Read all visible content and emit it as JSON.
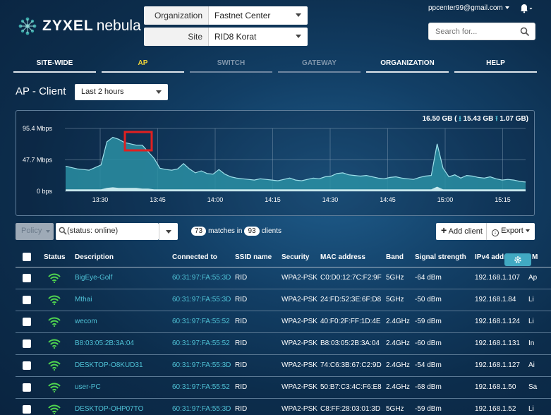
{
  "brand": {
    "name": "ZYXEL",
    "product": "nebula"
  },
  "org_selector": {
    "label": "Organization",
    "value": "Fastnet Center"
  },
  "site_selector": {
    "label": "Site",
    "value": "RID8 Korat"
  },
  "user": {
    "email": "ppcenter99@gmail.com"
  },
  "search": {
    "placeholder": "Search for..."
  },
  "nav": {
    "tabs": [
      {
        "label": "SITE-WIDE"
      },
      {
        "label": "AP"
      },
      {
        "label": "SWITCH"
      },
      {
        "label": "GATEWAY"
      },
      {
        "label": "ORGANIZATION"
      },
      {
        "label": "HELP"
      }
    ]
  },
  "page": {
    "title": "AP - Client",
    "time_range": "Last 2 hours"
  },
  "usage": {
    "total": "16.50 GB (",
    "down": "15.43 GB",
    "up": "1.07 GB)"
  },
  "chart_data": {
    "type": "area",
    "y_ticks": [
      "95.4 Mbps",
      "47.7 Mbps",
      "0 bps"
    ],
    "ylim": [
      0,
      95.4
    ],
    "x_ticks": [
      "13:30",
      "13:45",
      "14:00",
      "14:15",
      "14:30",
      "14:45",
      "15:00",
      "15:15"
    ],
    "grid": true,
    "series": [
      {
        "values": [
          38,
          36,
          34,
          33,
          32,
          36,
          40,
          75,
          82,
          79,
          74,
          72,
          70,
          70,
          60,
          50,
          35,
          33,
          32,
          34,
          42,
          34,
          28,
          31,
          27,
          26,
          33,
          26,
          22,
          20,
          19,
          18,
          17,
          19,
          18,
          17,
          16,
          18,
          20,
          17,
          16,
          18,
          20,
          19,
          22,
          23,
          27,
          28,
          25,
          24,
          23,
          24,
          22,
          20,
          19,
          21,
          22,
          20,
          19,
          18,
          21,
          23,
          24,
          72,
          35,
          22,
          25,
          20,
          24,
          23,
          21,
          20,
          22,
          19,
          17,
          18,
          17,
          15,
          14
        ]
      },
      {
        "values": [
          3,
          3,
          3,
          3,
          3,
          3,
          3,
          5,
          6,
          5,
          5,
          5,
          5,
          4,
          4,
          3,
          3,
          3,
          3,
          3,
          3,
          3,
          3,
          3,
          3,
          3,
          3,
          3,
          3,
          3,
          3,
          3,
          3,
          3,
          3,
          3,
          3,
          3,
          3,
          3,
          3,
          3,
          3,
          3,
          3,
          3,
          3,
          3,
          3,
          3,
          3,
          3,
          3,
          3,
          3,
          3,
          3,
          3,
          3,
          3,
          3,
          3,
          3,
          7,
          3,
          3,
          3,
          3,
          3,
          3,
          3,
          3,
          3,
          3,
          3,
          3,
          3,
          3,
          3
        ]
      }
    ]
  },
  "toolbar": {
    "policy_label": "Policy",
    "filter_value": "(status: online)",
    "matches_count": "73",
    "matches_in": "matches in",
    "clients_total": "93",
    "clients_label": "clients",
    "add_client": "Add client",
    "export": "Export"
  },
  "table": {
    "headers": [
      "Status",
      "Description",
      "Connected to",
      "SSID name",
      "Security",
      "MAC address",
      "Band",
      "Signal strength",
      "IPv4 addr",
      "M"
    ],
    "rows": [
      {
        "description": "BigEye-Golf",
        "connected_to": "60:31:97:FA:55:3D",
        "ssid": "RID",
        "security": "WPA2-PSK",
        "mac": "C0:D0:12:7C:F2:9F",
        "band": "5GHz",
        "signal": "-64 dBm",
        "ipv4": "192.168.1.107",
        "extra": "Ap"
      },
      {
        "description": "Mthai",
        "connected_to": "60:31:97:FA:55:3D",
        "ssid": "RID",
        "security": "WPA2-PSK",
        "mac": "24:FD:52:3E:6F:D8",
        "band": "5GHz",
        "signal": "-50 dBm",
        "ipv4": "192.168.1.84",
        "extra": "Li"
      },
      {
        "description": "wecom",
        "connected_to": "60:31:97:FA:55:52",
        "ssid": "RID",
        "security": "WPA2-PSK",
        "mac": "40:F0:2F:FF:1D:4E",
        "band": "2.4GHz",
        "signal": "-59 dBm",
        "ipv4": "192.168.1.124",
        "extra": "Li"
      },
      {
        "description": "B8:03:05:2B:3A:04",
        "connected_to": "60:31:97:FA:55:52",
        "ssid": "RID",
        "security": "WPA2-PSK",
        "mac": "B8:03:05:2B:3A:04",
        "band": "2.4GHz",
        "signal": "-60 dBm",
        "ipv4": "192.168.1.131",
        "extra": "In"
      },
      {
        "description": "DESKTOP-O8KUD31",
        "connected_to": "60:31:97:FA:55:3D",
        "ssid": "RID",
        "security": "WPA2-PSK",
        "mac": "74:C6:3B:67:C2:9D",
        "band": "2.4GHz",
        "signal": "-54 dBm",
        "ipv4": "192.168.1.127",
        "extra": "Ai"
      },
      {
        "description": "user-PC",
        "connected_to": "60:31:97:FA:55:52",
        "ssid": "RID",
        "security": "WPA2-PSK",
        "mac": "50:B7:C3:4C:F6:E8",
        "band": "2.4GHz",
        "signal": "-68 dBm",
        "ipv4": "192.168.1.50",
        "extra": "Sa"
      },
      {
        "description": "DESKTOP-OHP07TO",
        "connected_to": "60:31:97:FA:55:3D",
        "ssid": "RID",
        "security": "WPA2-PSK",
        "mac": "C8:FF:28:03:01:3D",
        "band": "5GHz",
        "signal": "-59 dBm",
        "ipv4": "192.168.1.52",
        "extra": "Li"
      }
    ]
  },
  "colors": {
    "accent": "#4fc2d6",
    "active_tab": "#f0d43a",
    "area_fill": "#2a8fa3",
    "signal_icon": "#4fd44f",
    "annotation": "#e02020"
  }
}
